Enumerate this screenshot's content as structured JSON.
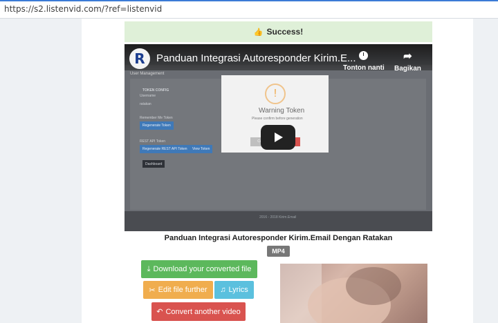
{
  "browser": {
    "url": "https://s2.listenvid.com/?ref=listenvid"
  },
  "alert": {
    "text": "Success!",
    "icon": "thumbs-up-icon"
  },
  "video": {
    "title": "Panduan Integrasi Autoresponder Kirim.E...",
    "channel_logo_letter": "R",
    "actions": [
      {
        "label": "Tonton nanti",
        "icon": "clock-icon"
      },
      {
        "label": "Bagikan",
        "icon": "share-icon"
      }
    ],
    "screenshot": {
      "header": "User Management",
      "token_label": "TOKEN CONFIG",
      "username_label": "Username",
      "username_value": "ratakan",
      "remember_label": "Remember Me Token",
      "regen_button": "Regenerate Token",
      "rest_label": "REST API Token",
      "regen_rest_button": "Regenerate REST API Token",
      "view_token_button": "View Token",
      "dashboard_button": "Dashboard",
      "dialog_title": "Warning Token",
      "dialog_text": "Please confirm before generation",
      "dialog_cancel": "Cancel",
      "dialog_yes": "Yes",
      "copyright": "2016 - 2018 Kirim.Email"
    }
  },
  "caption": "Panduan Integrasi Autoresponder Kirim.Email Dengan Ratakan",
  "format_badge": "MP4",
  "buttons": {
    "download": "Download your converted file",
    "edit": "Edit file further",
    "lyrics": "Lyrics",
    "convert": "Convert another video"
  },
  "colors": {
    "success_bg": "#dff0d8",
    "green": "#5cb85c",
    "orange": "#f0ad4e",
    "blue": "#5bc0de",
    "red": "#d9534f",
    "badge": "#777777"
  }
}
